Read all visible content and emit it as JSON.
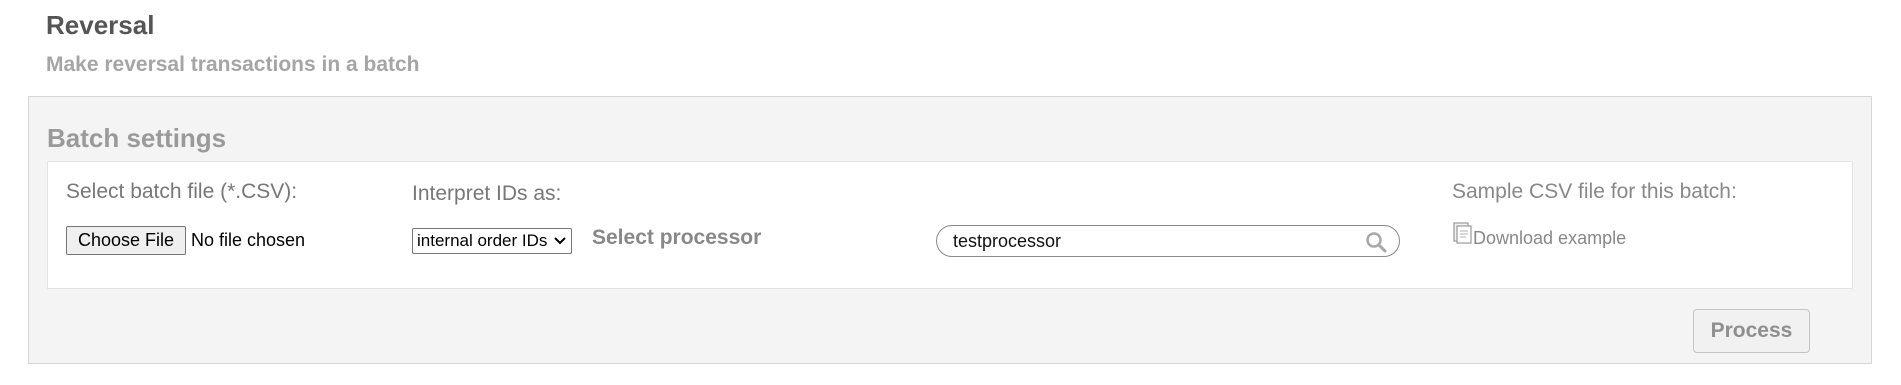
{
  "header": {
    "title": "Reversal",
    "subtitle": "Make reversal transactions in a batch"
  },
  "batch_settings": {
    "title": "Batch settings",
    "file": {
      "label": "Select batch file (*.CSV):",
      "button_label": "Choose File",
      "status": "No file chosen"
    },
    "interpret": {
      "label": "Interpret IDs as:",
      "selected_option": "internal order IDs"
    },
    "processor": {
      "label": "Select processor",
      "search_value": "testprocessor",
      "search_icon": "search-icon"
    },
    "sample": {
      "label": "Sample CSV file for this batch:",
      "link_label": "Download example",
      "link_icon": "document-icon"
    }
  },
  "actions": {
    "process_label": "Process"
  }
}
